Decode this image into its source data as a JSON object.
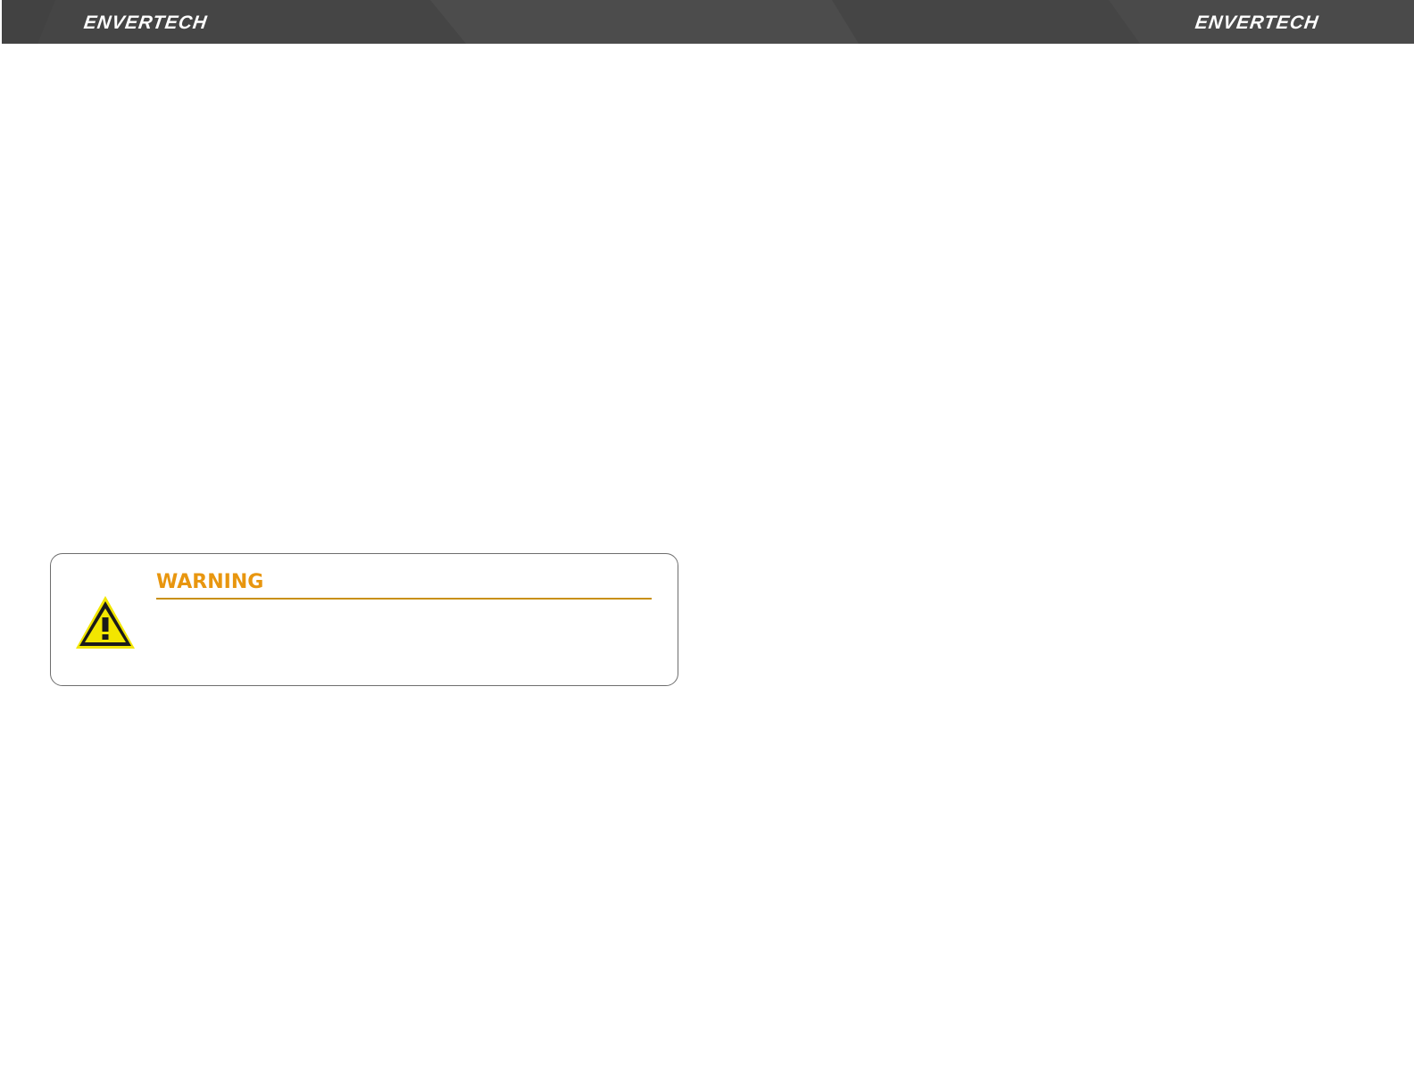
{
  "header": {
    "brand_left": "ENVERTECH",
    "brand_right": "ENVERTECH",
    "background_color": "#454545"
  },
  "warning": {
    "title": "WARNING",
    "icon": "warning-triangle-icon",
    "title_color": "#e8960f",
    "icon_color": "#f2e600"
  }
}
